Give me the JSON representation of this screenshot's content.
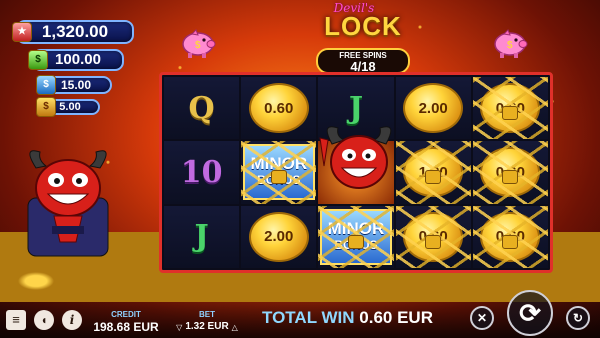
{
  "jackpots": {
    "grand": "1,320.00",
    "major": "100.00",
    "minor": "15.00",
    "mini": "5.00",
    "icons": [
      "grand-jackpot-icon",
      "major-jackpot-icon",
      "minor-jackpot-icon",
      "mini-jackpot-icon"
    ]
  },
  "logo": {
    "line1": "Devil's",
    "line2": "LOCK"
  },
  "free_spins": {
    "label": "FREE SPINS",
    "count": "4/18"
  },
  "reels": {
    "row1": {
      "c1": "Q",
      "c2": "0.60",
      "c3": "J",
      "c4": "2.00",
      "c5": "0.60"
    },
    "row2": {
      "c1": "10",
      "c2a": "MINOR",
      "c2b": "BONUS",
      "c4": "1.20",
      "c5": "0.60"
    },
    "row3": {
      "c1": "J",
      "c2": "2.00",
      "c3a": "MINOR",
      "c3b": "BONUS",
      "c4": "0.60",
      "c5": "0.60"
    }
  },
  "bottom_bar": {
    "credit_label": "CREDIT",
    "credit_value": "198.68 EUR",
    "bet_label": "BET",
    "bet_value": "1.32 EUR",
    "total_win_label": "TOTAL WIN",
    "total_win_value": "0.60 EUR"
  },
  "colors": {
    "accent": "#ffcf3d",
    "reel_border": "#e0302a",
    "label_blue": "#8fd8ff"
  }
}
